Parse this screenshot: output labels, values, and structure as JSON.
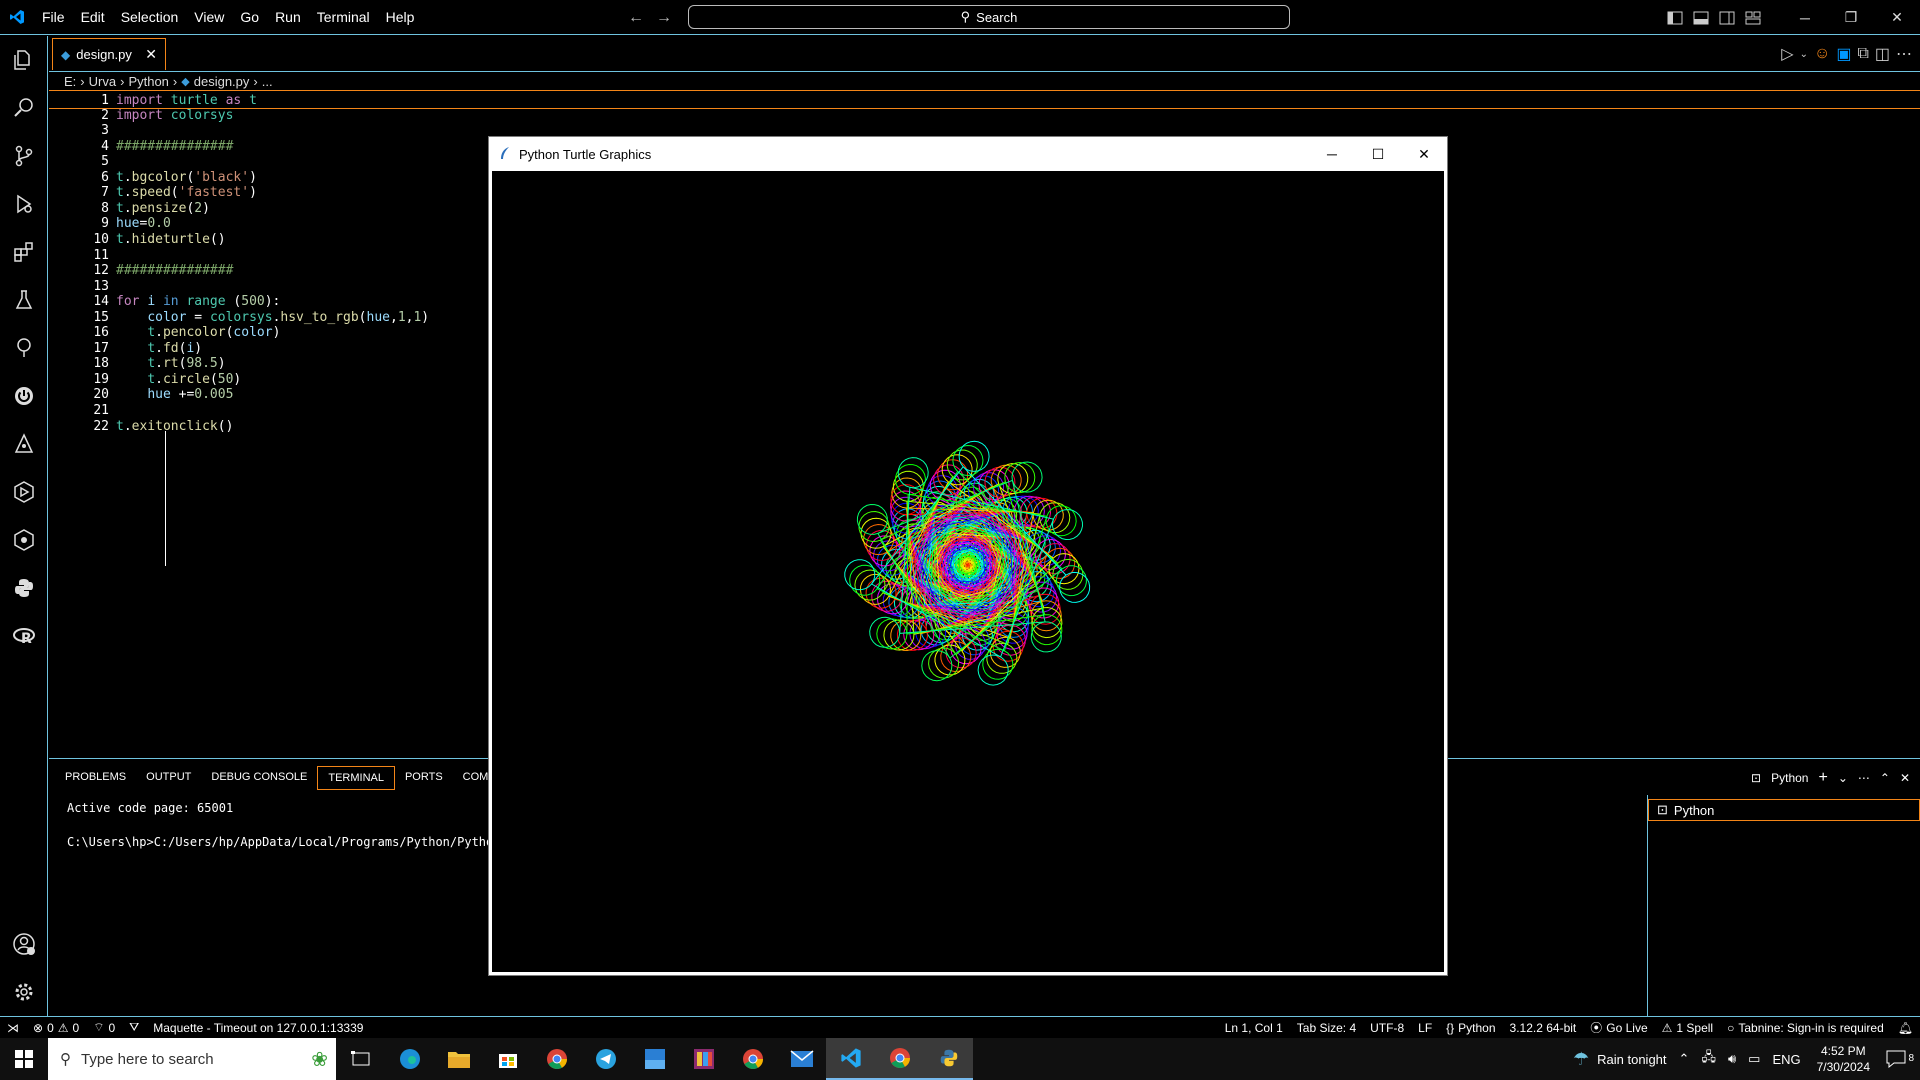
{
  "menu": [
    "File",
    "Edit",
    "Selection",
    "View",
    "Go",
    "Run",
    "Terminal",
    "Help"
  ],
  "search": {
    "label": "Search"
  },
  "tab": {
    "filename": "design.py"
  },
  "breadcrumb": [
    "E:",
    "Urva",
    "Python",
    "design.py",
    "..."
  ],
  "code": [
    {
      "n": "1",
      "t": [
        [
          "kw",
          "import"
        ],
        [
          "plain",
          " "
        ],
        [
          "mod",
          "turtle"
        ],
        [
          "plain",
          " "
        ],
        [
          "kw",
          "as"
        ],
        [
          "plain",
          " "
        ],
        [
          "mod",
          "t"
        ]
      ]
    },
    {
      "n": "2",
      "t": [
        [
          "kw",
          "import"
        ],
        [
          "plain",
          " "
        ],
        [
          "mod",
          "colorsys"
        ]
      ]
    },
    {
      "n": "3",
      "t": []
    },
    {
      "n": "4",
      "t": [
        [
          "cm",
          "###############"
        ]
      ]
    },
    {
      "n": "5",
      "t": []
    },
    {
      "n": "6",
      "t": [
        [
          "mod",
          "t"
        ],
        [
          "plain",
          "."
        ],
        [
          "fn",
          "bgcolor"
        ],
        [
          "plain",
          "("
        ],
        [
          "str",
          "'black'"
        ],
        [
          "plain",
          ")"
        ]
      ]
    },
    {
      "n": "7",
      "t": [
        [
          "mod",
          "t"
        ],
        [
          "plain",
          "."
        ],
        [
          "fn",
          "speed"
        ],
        [
          "plain",
          "("
        ],
        [
          "str",
          "'fastest'"
        ],
        [
          "plain",
          ")"
        ]
      ]
    },
    {
      "n": "8",
      "t": [
        [
          "mod",
          "t"
        ],
        [
          "plain",
          "."
        ],
        [
          "fn",
          "pensize"
        ],
        [
          "plain",
          "("
        ],
        [
          "num",
          "2"
        ],
        [
          "plain",
          ")"
        ]
      ]
    },
    {
      "n": "9",
      "t": [
        [
          "var",
          "hue"
        ],
        [
          "plain",
          "="
        ],
        [
          "num",
          "0.0"
        ]
      ]
    },
    {
      "n": "10",
      "t": [
        [
          "mod",
          "t"
        ],
        [
          "plain",
          "."
        ],
        [
          "fn",
          "hideturtle"
        ],
        [
          "plain",
          "()"
        ]
      ]
    },
    {
      "n": "11",
      "t": []
    },
    {
      "n": "12",
      "t": [
        [
          "cm",
          "###############"
        ]
      ]
    },
    {
      "n": "13",
      "t": []
    },
    {
      "n": "14",
      "t": [
        [
          "kw",
          "for"
        ],
        [
          "plain",
          " "
        ],
        [
          "var",
          "i"
        ],
        [
          "plain",
          " "
        ],
        [
          "kb",
          "in"
        ],
        [
          "plain",
          " "
        ],
        [
          "mod",
          "range"
        ],
        [
          "plain",
          " ("
        ],
        [
          "num",
          "500"
        ],
        [
          "plain",
          "):"
        ]
      ]
    },
    {
      "n": "15",
      "t": [
        [
          "plain",
          "    "
        ],
        [
          "var",
          "color"
        ],
        [
          "plain",
          " = "
        ],
        [
          "mod",
          "colorsys"
        ],
        [
          "plain",
          "."
        ],
        [
          "fn",
          "hsv_to_rgb"
        ],
        [
          "plain",
          "("
        ],
        [
          "var",
          "hue"
        ],
        [
          "plain",
          ","
        ],
        [
          "num",
          "1"
        ],
        [
          "plain",
          ","
        ],
        [
          "num",
          "1"
        ],
        [
          "plain",
          ")"
        ]
      ]
    },
    {
      "n": "16",
      "t": [
        [
          "plain",
          "    "
        ],
        [
          "mod",
          "t"
        ],
        [
          "plain",
          "."
        ],
        [
          "fn",
          "pencolor"
        ],
        [
          "plain",
          "("
        ],
        [
          "var",
          "color"
        ],
        [
          "plain",
          ")"
        ]
      ]
    },
    {
      "n": "17",
      "t": [
        [
          "plain",
          "    "
        ],
        [
          "mod",
          "t"
        ],
        [
          "plain",
          "."
        ],
        [
          "fn",
          "fd"
        ],
        [
          "plain",
          "("
        ],
        [
          "var",
          "i"
        ],
        [
          "plain",
          ")"
        ]
      ]
    },
    {
      "n": "18",
      "t": [
        [
          "plain",
          "    "
        ],
        [
          "mod",
          "t"
        ],
        [
          "plain",
          "."
        ],
        [
          "fn",
          "rt"
        ],
        [
          "plain",
          "("
        ],
        [
          "num",
          "98.5"
        ],
        [
          "plain",
          ")"
        ]
      ]
    },
    {
      "n": "19",
      "t": [
        [
          "plain",
          "    "
        ],
        [
          "mod",
          "t"
        ],
        [
          "plain",
          "."
        ],
        [
          "fn",
          "circle"
        ],
        [
          "plain",
          "("
        ],
        [
          "num",
          "50"
        ],
        [
          "plain",
          ")"
        ]
      ]
    },
    {
      "n": "20",
      "t": [
        [
          "plain",
          "    "
        ],
        [
          "var",
          "hue"
        ],
        [
          "plain",
          " +="
        ],
        [
          "num",
          "0.005"
        ]
      ]
    },
    {
      "n": "21",
      "t": []
    },
    {
      "n": "22",
      "t": [
        [
          "mod",
          "t"
        ],
        [
          "plain",
          "."
        ],
        [
          "fn",
          "exitonclick"
        ],
        [
          "plain",
          "()"
        ]
      ]
    }
  ],
  "panel": {
    "tabs": [
      "PROBLEMS",
      "OUTPUT",
      "DEBUG CONSOLE",
      "TERMINAL",
      "PORTS",
      "COMM"
    ],
    "active_tab": "TERMINAL",
    "terminal_lines": [
      "Active code page: 65001",
      "",
      "C:\\Users\\hp>C:/Users/hp/AppData/Local/Programs/Python/Python"
    ],
    "profile": "Python",
    "terminal_list_item": "Python"
  },
  "turtle_window": {
    "title": "Python Turtle Graphics",
    "pattern": {
      "steps": 500,
      "turn_deg": 98.5,
      "circle_radius": 50,
      "hue_start": 0.0,
      "hue_step": 0.005,
      "pensize": 2,
      "bg": "#000000"
    }
  },
  "status": {
    "errors": "0",
    "warnings": "0",
    "ports": "0",
    "maquette": "Maquette - Timeout on 127.0.0.1:13339",
    "ln_col": "Ln 1, Col 1",
    "tab_size": "Tab Size: 4",
    "encoding": "UTF-8",
    "eol": "LF",
    "language": "Python",
    "interpreter": "3.12.2 64-bit",
    "golive": "Go Live",
    "spell": "1 Spell",
    "tabnine": "Tabnine: Sign-in is required"
  },
  "taskbar": {
    "search_placeholder": "Type here to search",
    "weather": "Rain tonight",
    "lang": "ENG",
    "time": "4:52 PM",
    "date": "7/30/2024",
    "notif_count": "8"
  },
  "colors": {
    "accent_border": "#6fc3df",
    "active_border": "#f38518",
    "vscode_blue": "#0098ff"
  }
}
